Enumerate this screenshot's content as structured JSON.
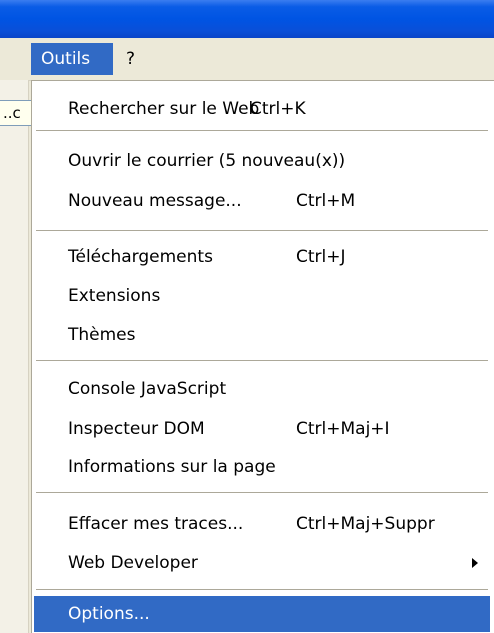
{
  "menubar": {
    "outils": "Outils",
    "help": "?"
  },
  "left_field": {
    "value": "..c"
  },
  "menu": {
    "search_web": {
      "label": "Rechercher sur le Web",
      "shortcut": "Ctrl+K"
    },
    "open_mail": {
      "label": "Ouvrir le courrier (5 nouveau(x))"
    },
    "new_message": {
      "label": "Nouveau message...",
      "shortcut": "Ctrl+M"
    },
    "downloads": {
      "label": "Téléchargements",
      "shortcut": "Ctrl+J"
    },
    "extensions": {
      "label": "Extensions"
    },
    "themes": {
      "label": "Thèmes"
    },
    "js_console": {
      "label": "Console JavaScript"
    },
    "dom_inspector": {
      "label": "Inspecteur DOM",
      "shortcut": "Ctrl+Maj+I"
    },
    "page_info": {
      "label": "Informations sur la page"
    },
    "clear_traces": {
      "label": "Effacer mes traces...",
      "shortcut": "Ctrl+Maj+Suppr"
    },
    "web_developer": {
      "label": "Web Developer"
    },
    "options": {
      "label": "Options..."
    }
  },
  "colors": {
    "titlebar": "#0054e3",
    "menu_selected": "#316ac5",
    "menu_bg": "#ffffff",
    "chrome_bg": "#ece9d8"
  }
}
